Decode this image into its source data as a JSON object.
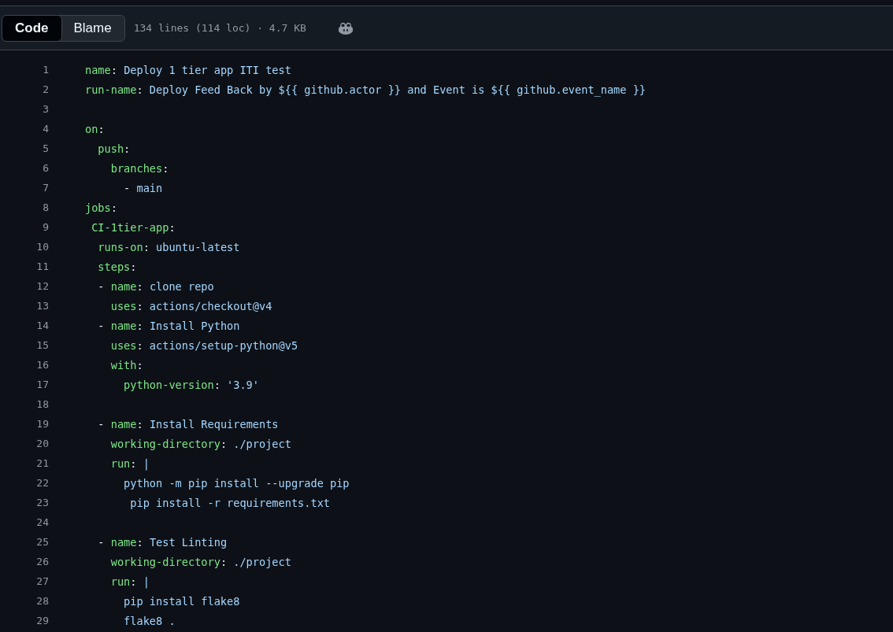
{
  "toolbar": {
    "tabs": [
      {
        "label": "Code",
        "selected": true
      },
      {
        "label": "Blame",
        "selected": false
      }
    ],
    "file_info": "134 lines (114 loc) · 4.7 KB"
  },
  "code": {
    "lines": [
      {
        "number": "1",
        "tokens": [
          {
            "kind": "key",
            "text": "name"
          },
          {
            "kind": "punct",
            "text": ": "
          },
          {
            "kind": "value",
            "text": "Deploy 1 tier app ITI test"
          }
        ]
      },
      {
        "number": "2",
        "tokens": [
          {
            "kind": "key",
            "text": "run-name"
          },
          {
            "kind": "punct",
            "text": ": "
          },
          {
            "kind": "value",
            "text": "Deploy Feed Back by ${{ github.actor }} and Event is ${{ github.event_name }}"
          }
        ]
      },
      {
        "number": "3"
      },
      {
        "number": "4",
        "tokens": [
          {
            "kind": "key",
            "text": "on"
          },
          {
            "kind": "punct",
            "text": ":"
          }
        ]
      },
      {
        "number": "5",
        "tokens": [
          {
            "kind": "key",
            "text": "  push"
          },
          {
            "kind": "punct",
            "text": ":"
          }
        ]
      },
      {
        "number": "6",
        "tokens": [
          {
            "kind": "key",
            "text": "    branches"
          },
          {
            "kind": "punct",
            "text": ":"
          }
        ]
      },
      {
        "number": "7",
        "tokens": [
          {
            "kind": "punct",
            "text": "      - "
          },
          {
            "kind": "value",
            "text": "main"
          }
        ]
      },
      {
        "number": "8",
        "tokens": [
          {
            "kind": "key",
            "text": "jobs"
          },
          {
            "kind": "punct",
            "text": ":"
          }
        ]
      },
      {
        "number": "9",
        "tokens": [
          {
            "kind": "key",
            "text": " CI-1tier-app"
          },
          {
            "kind": "punct",
            "text": ":"
          }
        ]
      },
      {
        "number": "10",
        "tokens": [
          {
            "kind": "key",
            "text": "  runs-on"
          },
          {
            "kind": "punct",
            "text": ": "
          },
          {
            "kind": "value",
            "text": "ubuntu-latest"
          }
        ]
      },
      {
        "number": "11",
        "tokens": [
          {
            "kind": "key",
            "text": "  steps"
          },
          {
            "kind": "punct",
            "text": ":"
          }
        ]
      },
      {
        "number": "12",
        "tokens": [
          {
            "kind": "punct",
            "text": "  - "
          },
          {
            "kind": "key",
            "text": "name"
          },
          {
            "kind": "punct",
            "text": ": "
          },
          {
            "kind": "value",
            "text": "clone repo"
          }
        ]
      },
      {
        "number": "13",
        "tokens": [
          {
            "kind": "key",
            "text": "    uses"
          },
          {
            "kind": "punct",
            "text": ": "
          },
          {
            "kind": "value",
            "text": "actions/checkout@v4"
          }
        ]
      },
      {
        "number": "14",
        "tokens": [
          {
            "kind": "punct",
            "text": "  - "
          },
          {
            "kind": "key",
            "text": "name"
          },
          {
            "kind": "punct",
            "text": ": "
          },
          {
            "kind": "value",
            "text": "Install Python"
          }
        ]
      },
      {
        "number": "15",
        "tokens": [
          {
            "kind": "key",
            "text": "    uses"
          },
          {
            "kind": "punct",
            "text": ": "
          },
          {
            "kind": "value",
            "text": "actions/setup-python@v5"
          }
        ]
      },
      {
        "number": "16",
        "tokens": [
          {
            "kind": "key",
            "text": "    with"
          },
          {
            "kind": "punct",
            "text": ":"
          }
        ]
      },
      {
        "number": "17",
        "tokens": [
          {
            "kind": "key",
            "text": "      python-version"
          },
          {
            "kind": "punct",
            "text": ": "
          },
          {
            "kind": "value",
            "text": "'3.9'"
          }
        ]
      },
      {
        "number": "18"
      },
      {
        "number": "19",
        "tokens": [
          {
            "kind": "punct",
            "text": "  - "
          },
          {
            "kind": "key",
            "text": "name"
          },
          {
            "kind": "punct",
            "text": ": "
          },
          {
            "kind": "value",
            "text": "Install Requirements"
          }
        ]
      },
      {
        "number": "20",
        "tokens": [
          {
            "kind": "key",
            "text": "    working-directory"
          },
          {
            "kind": "punct",
            "text": ": "
          },
          {
            "kind": "value",
            "text": "./project"
          }
        ]
      },
      {
        "number": "21",
        "tokens": [
          {
            "kind": "key",
            "text": "    run"
          },
          {
            "kind": "punct",
            "text": ": "
          },
          {
            "kind": "value",
            "text": "|"
          }
        ]
      },
      {
        "number": "22",
        "tokens": [
          {
            "kind": "value",
            "text": "      python -m pip install --upgrade pip"
          }
        ]
      },
      {
        "number": "23",
        "tokens": [
          {
            "kind": "value",
            "text": "       pip install -r requirements.txt"
          }
        ]
      },
      {
        "number": "24"
      },
      {
        "number": "25",
        "tokens": [
          {
            "kind": "punct",
            "text": "  - "
          },
          {
            "kind": "key",
            "text": "name"
          },
          {
            "kind": "punct",
            "text": ": "
          },
          {
            "kind": "value",
            "text": "Test Linting"
          }
        ]
      },
      {
        "number": "26",
        "tokens": [
          {
            "kind": "key",
            "text": "    working-directory"
          },
          {
            "kind": "punct",
            "text": ": "
          },
          {
            "kind": "value",
            "text": "./project"
          }
        ]
      },
      {
        "number": "27",
        "tokens": [
          {
            "kind": "key",
            "text": "    run"
          },
          {
            "kind": "punct",
            "text": ": "
          },
          {
            "kind": "value",
            "text": "|"
          }
        ]
      },
      {
        "number": "28",
        "tokens": [
          {
            "kind": "value",
            "text": "      pip install flake8"
          }
        ]
      },
      {
        "number": "29",
        "tokens": [
          {
            "kind": "value",
            "text": "      flake8 ."
          }
        ]
      }
    ]
  }
}
